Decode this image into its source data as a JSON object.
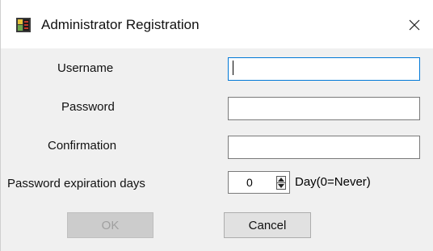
{
  "window": {
    "title": "Administrator Registration",
    "icon": "app-icon",
    "close_glyph": "✕"
  },
  "form": {
    "username_label": "Username",
    "username_value": "",
    "password_label": "Password",
    "password_value": "",
    "confirmation_label": "Confirmation",
    "confirmation_value": "",
    "expiration_label": "Password expiration days",
    "expiration_value": "0",
    "expiration_unit": "Day(0=Never)"
  },
  "buttons": {
    "ok_label": "OK",
    "ok_enabled": false,
    "cancel_label": "Cancel"
  },
  "colors": {
    "focus_border": "#0078d7",
    "disabled_text": "#a0a0a0"
  }
}
